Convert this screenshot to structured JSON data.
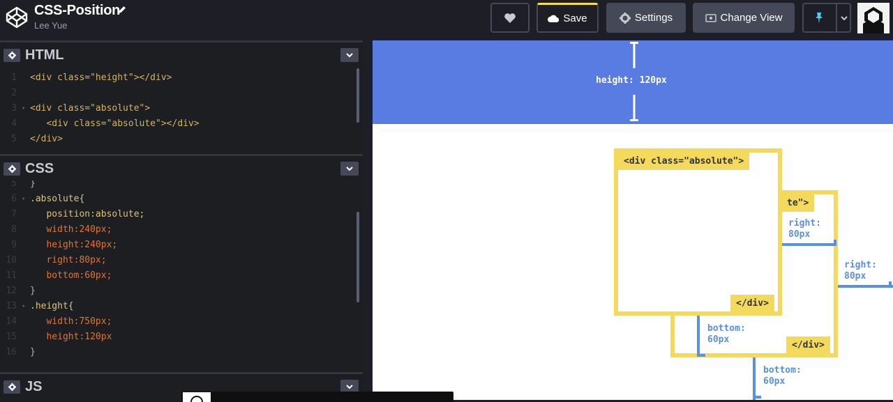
{
  "header": {
    "title": "CSS-Position",
    "author": "Lee Yue",
    "buttons": {
      "save": "Save",
      "settings": "Settings",
      "change_view": "Change View"
    },
    "accent": "#ffdd40"
  },
  "panes": {
    "html": {
      "title": "HTML",
      "lines": [
        {
          "n": "1",
          "code": "<div class=\"height\"></div>"
        },
        {
          "n": "2",
          "code": ""
        },
        {
          "n": "3",
          "code": "<div class=\"absolute\">"
        },
        {
          "n": "4",
          "code": "   <div class=\"absolute\"></div>"
        },
        {
          "n": "5",
          "code": "</div>"
        }
      ]
    },
    "css": {
      "title": "CSS",
      "lines": [
        {
          "n": "5",
          "code": "}"
        },
        {
          "n": "6",
          "code": ".absolute{"
        },
        {
          "n": "7",
          "code": "   position:absolute;"
        },
        {
          "n": "8",
          "code": "   width:240px;"
        },
        {
          "n": "9",
          "code": "   height:240px;"
        },
        {
          "n": "10",
          "code": "   right:80px;"
        },
        {
          "n": "11",
          "code": "   bottom:60px;"
        },
        {
          "n": "12",
          "code": "}"
        },
        {
          "n": "13",
          "code": ".height{"
        },
        {
          "n": "14",
          "code": "   width:750px;"
        },
        {
          "n": "15",
          "code": "   height:120px"
        },
        {
          "n": "16",
          "code": "}"
        }
      ]
    },
    "js": {
      "title": "JS"
    }
  },
  "preview": {
    "height_label": "height: 120px",
    "outer_tag_open": "<div class=\"absolute\">",
    "inner_tag_partial": "te\">",
    "close_tag": "</div>",
    "right_label_a": "right:",
    "right_value_a": "80px",
    "right_label_b": "right:",
    "right_value_b": "80px",
    "bottom_label_a": "bottom:",
    "bottom_value_a": "60px",
    "bottom_label_b": "bottom:",
    "bottom_value_b": "60px",
    "colors": {
      "blue": "#587ce1",
      "yellow": "#f3da5c",
      "dim": "#5a8fe6"
    }
  }
}
